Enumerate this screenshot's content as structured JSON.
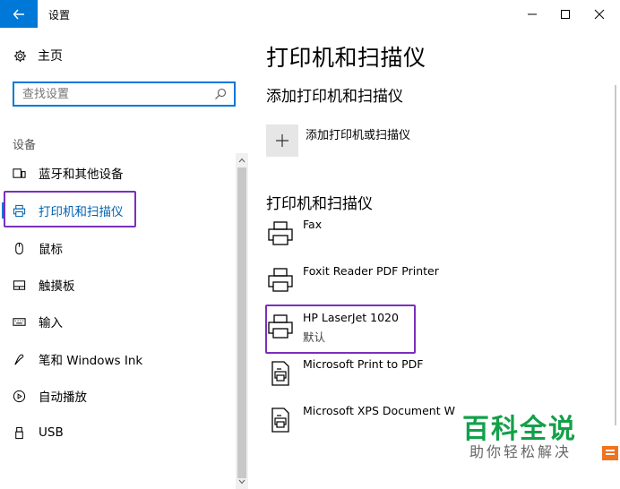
{
  "window": {
    "title": "设置",
    "back_icon": "back-arrow-icon",
    "controls": [
      "minimize",
      "maximize",
      "close"
    ]
  },
  "sidebar": {
    "home_label": "主页",
    "home_icon": "gear-icon",
    "search_placeholder": "查找设置",
    "section_label": "设备",
    "items": [
      {
        "label": "蓝牙和其他设备",
        "icon": "bluetooth-devices-icon"
      },
      {
        "label": "打印机和扫描仪",
        "icon": "printer-icon",
        "active": true
      },
      {
        "label": "鼠标",
        "icon": "mouse-icon"
      },
      {
        "label": "触摸板",
        "icon": "touchpad-icon"
      },
      {
        "label": "输入",
        "icon": "keyboard-icon"
      },
      {
        "label": "笔和 Windows Ink",
        "icon": "pen-icon"
      },
      {
        "label": "自动播放",
        "icon": "autoplay-icon"
      },
      {
        "label": "USB",
        "icon": "usb-icon"
      }
    ]
  },
  "main": {
    "title": "打印机和扫描仪",
    "add_section_title": "添加打印机和扫描仪",
    "add_button_label": "添加打印机或扫描仪",
    "printers_section_title": "打印机和扫描仪",
    "printers": [
      {
        "name": "Fax",
        "status": ""
      },
      {
        "name": "Foxit Reader PDF Printer",
        "status": ""
      },
      {
        "name": "HP LaserJet 1020",
        "status": "默认"
      },
      {
        "name": "Microsoft Print to PDF",
        "status": ""
      },
      {
        "name": "Microsoft XPS Document W",
        "status": ""
      }
    ]
  },
  "watermark": {
    "main": "百科全说",
    "sub": "助你轻松解决"
  },
  "colors": {
    "accent": "#0078d7",
    "highlight": "#7b2fbe",
    "watermark_green": "#14a04a"
  }
}
